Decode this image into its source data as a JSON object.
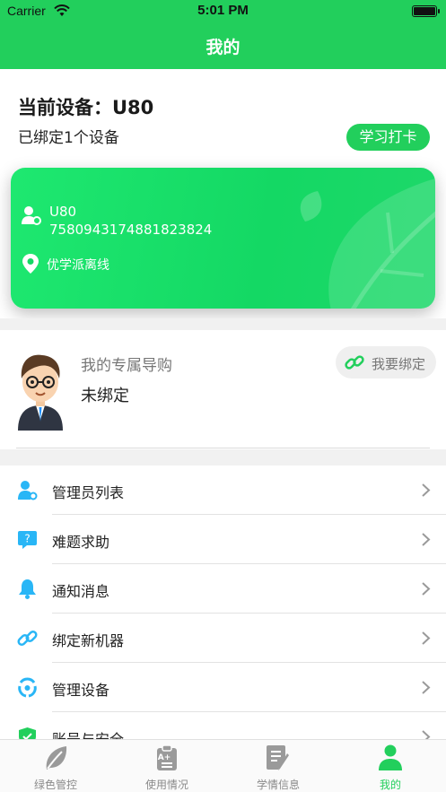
{
  "status_bar": {
    "carrier": "Carrier",
    "time": "5:01 PM"
  },
  "nav": {
    "title": "我的"
  },
  "device": {
    "title": "当前设备：U80",
    "bound_count": "已绑定1个设备",
    "checkin_label": "学习打卡",
    "card": {
      "model": "U80",
      "serial": "7580943174881823824",
      "status": "优学派离线"
    }
  },
  "guide": {
    "label": "我的专属导购",
    "status": "未绑定",
    "bind_label": "我要绑定"
  },
  "menu": {
    "items": [
      {
        "label": "管理员列表",
        "icon": "admin-list-icon"
      },
      {
        "label": "难题求助",
        "icon": "help-icon"
      },
      {
        "label": "通知消息",
        "icon": "bell-icon"
      },
      {
        "label": "绑定新机器",
        "icon": "link-icon"
      },
      {
        "label": "管理设备",
        "icon": "device-manage-icon"
      },
      {
        "label": "账号与安全",
        "icon": "shield-icon"
      }
    ]
  },
  "tabs": [
    {
      "label": "绿色管控",
      "icon": "leaf-icon",
      "active": false
    },
    {
      "label": "使用情况",
      "icon": "clipboard-icon",
      "active": false
    },
    {
      "label": "学情信息",
      "icon": "document-icon",
      "active": false
    },
    {
      "label": "我的",
      "icon": "person-icon",
      "active": true
    }
  ],
  "colors": {
    "primary": "#22cf5c",
    "card": "#14d864",
    "icon_blue": "#29b6f6",
    "inactive_tab": "#8a8a8a"
  }
}
